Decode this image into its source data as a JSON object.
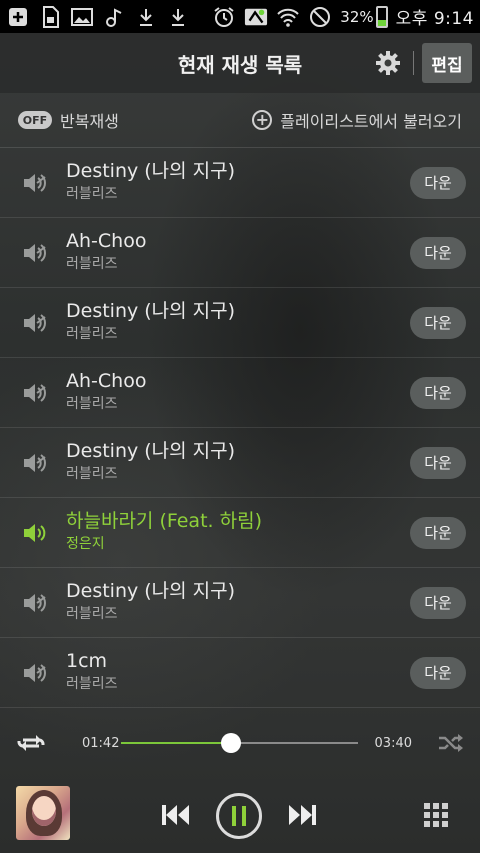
{
  "status_bar": {
    "battery_percent": "32%",
    "battery_level": 0.32,
    "time": "오후 9:14"
  },
  "header": {
    "title": "현재 재생 목록",
    "edit_label": "편집"
  },
  "subbar": {
    "repeat_toggle": "OFF",
    "repeat_label": "반복재생",
    "load_playlist_label": "플레이리스트에서 불러오기"
  },
  "download_label": "다운",
  "tracks": [
    {
      "title": "Destiny (나의 지구)",
      "artist": "러블리즈",
      "active": false
    },
    {
      "title": "Ah-Choo",
      "artist": "러블리즈",
      "active": false
    },
    {
      "title": "Destiny (나의 지구)",
      "artist": "러블리즈",
      "active": false
    },
    {
      "title": "Ah-Choo",
      "artist": "러블리즈",
      "active": false
    },
    {
      "title": "Destiny (나의 지구)",
      "artist": "러블리즈",
      "active": false
    },
    {
      "title": "하늘바라기 (Feat. 하림)",
      "artist": "정은지",
      "active": true
    },
    {
      "title": "Destiny (나의 지구)",
      "artist": "러블리즈",
      "active": false
    },
    {
      "title": "1cm",
      "artist": "러블리즈",
      "active": false
    }
  ],
  "progress": {
    "elapsed": "01:42",
    "total": "03:40",
    "fraction": 0.464
  },
  "colors": {
    "accent": "#8fd13a"
  },
  "icons": {
    "repeat": "repeat-icon",
    "shuffle": "shuffle-icon",
    "previous": "previous-icon",
    "pause": "pause-icon",
    "next": "next-icon",
    "grid": "grid-menu-icon",
    "settings": "gear-icon"
  }
}
